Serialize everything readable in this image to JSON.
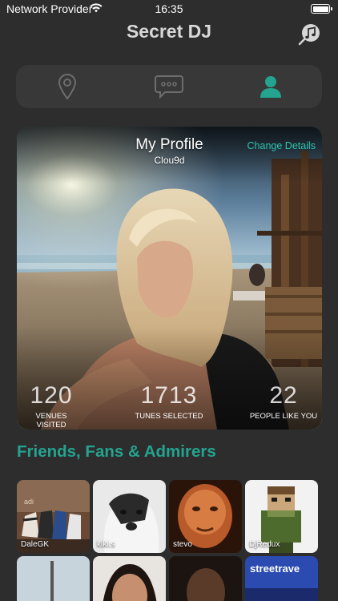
{
  "status_bar": {
    "carrier": "Network Provider",
    "time": "16:35"
  },
  "nav": {
    "title": "Secret DJ",
    "music_icon": "music-note-icon"
  },
  "tabs": [
    {
      "name": "venues",
      "icon": "map-pin-icon",
      "selected": false
    },
    {
      "name": "chat",
      "icon": "speech-bubble-icon",
      "selected": false
    },
    {
      "name": "profile",
      "icon": "person-icon",
      "selected": true
    }
  ],
  "profile": {
    "title": "My Profile",
    "username": "Clou9d",
    "change_details": "Change Details",
    "stats": [
      {
        "value": "120",
        "label": "VENUES VISITED"
      },
      {
        "value": "1713",
        "label": "TUNES SELECTED"
      },
      {
        "value": "22",
        "label": "PEOPLE LIKE YOU"
      }
    ]
  },
  "friends": {
    "heading": "Friends, Fans & Admirers",
    "items": [
      {
        "name": "DaleGK"
      },
      {
        "name": "kiki.s"
      },
      {
        "name": "stevo"
      },
      {
        "name": "DjRedux"
      },
      {
        "name": ""
      },
      {
        "name": ""
      },
      {
        "name": ""
      },
      {
        "name": ""
      }
    ]
  },
  "colors": {
    "accent": "#24a38f",
    "background": "#2d2d2d",
    "tab_bar": "#383838"
  }
}
